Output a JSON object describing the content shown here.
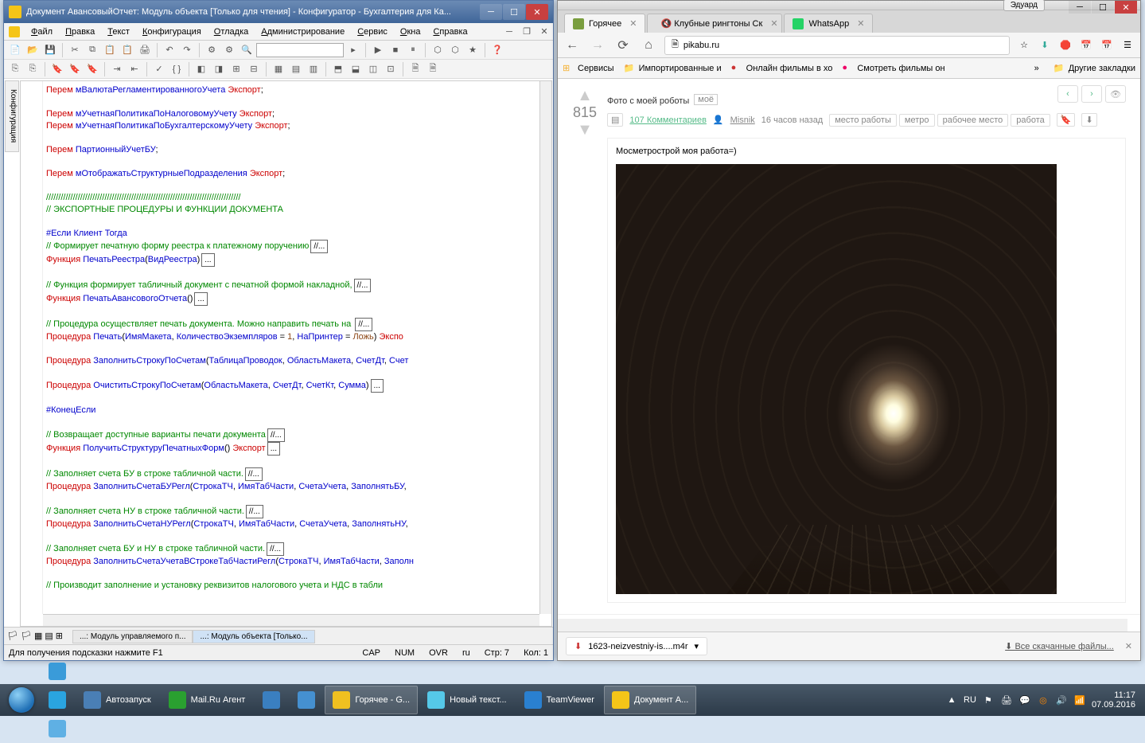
{
  "leftWindow": {
    "title": "Документ АвансовыйОтчет: Модуль объекта [Только для чтения] - Конфигуратор - Бухгалтерия для Ка...",
    "menu": [
      "Файл",
      "Правка",
      "Текст",
      "Конфигурация",
      "Отладка",
      "Администрирование",
      "Сервис",
      "Окна",
      "Справка"
    ],
    "sidebarTab": "Конфигурация",
    "code": [
      {
        "t": "",
        "p": [
          [
            "kw-red",
            "Перем "
          ],
          [
            "kw-blue",
            "мВалютаРегламентированногоУчета "
          ],
          [
            "kw-red",
            "Экспорт"
          ],
          [
            "",
            ";"
          ]
        ]
      },
      {
        "t": "blank"
      },
      {
        "t": "",
        "p": [
          [
            "kw-red",
            "Перем "
          ],
          [
            "kw-blue",
            "мУчетнаяПолитикаПоНалоговомуУчету "
          ],
          [
            "kw-red",
            "Экспорт"
          ],
          [
            "",
            ";"
          ]
        ]
      },
      {
        "t": "",
        "p": [
          [
            "kw-red",
            "Перем "
          ],
          [
            "kw-blue",
            "мУчетнаяПолитикаПоБухгалтерскомуУчету "
          ],
          [
            "kw-red",
            "Экспорт"
          ],
          [
            "",
            ";"
          ]
        ]
      },
      {
        "t": "blank"
      },
      {
        "t": "",
        "p": [
          [
            "kw-red",
            "Перем "
          ],
          [
            "kw-blue",
            "ПартионныйУчетБУ"
          ],
          [
            "",
            ";"
          ]
        ]
      },
      {
        "t": "blank"
      },
      {
        "t": "",
        "p": [
          [
            "kw-red",
            "Перем "
          ],
          [
            "kw-blue",
            "мОтображатьСтруктурныеПодразделения "
          ],
          [
            "kw-red",
            "Экспорт"
          ],
          [
            "",
            ";"
          ]
        ]
      },
      {
        "t": "blank"
      },
      {
        "t": "",
        "p": [
          [
            "kw-green",
            "////////////////////////////////////////////////////////////////////////////////"
          ]
        ]
      },
      {
        "t": "",
        "p": [
          [
            "kw-green",
            "// ЭКСПОРТНЫЕ ПРОЦЕДУРЫ И ФУНКЦИИ ДОКУМЕНТА"
          ]
        ]
      },
      {
        "t": "blank"
      },
      {
        "t": "",
        "p": [
          [
            "kw-blue",
            "#Если Клиент Тогда"
          ]
        ]
      },
      {
        "t": "fold",
        "p": [
          [
            "kw-green",
            "// Формирует печатную форму реестра к платежному поручению"
          ]
        ],
        "box": "//..."
      },
      {
        "t": "fold",
        "p": [
          [
            "kw-red",
            "Функция "
          ],
          [
            "kw-blue",
            "ПечатьРеестра"
          ],
          [
            "",
            "("
          ],
          [
            "kw-blue",
            "ВидРеестра"
          ],
          [
            "",
            ")"
          ]
        ],
        "box": "..."
      },
      {
        "t": "blank"
      },
      {
        "t": "fold",
        "p": [
          [
            "kw-green",
            "// Функция формирует табличный документ с печатной формой накладной,"
          ]
        ],
        "box": "//..."
      },
      {
        "t": "fold",
        "p": [
          [
            "kw-red",
            "Функция "
          ],
          [
            "kw-blue",
            "ПечатьАвансовогоОтчета"
          ],
          [
            "",
            "()"
          ]
        ],
        "box": "..."
      },
      {
        "t": "blank"
      },
      {
        "t": "fold",
        "p": [
          [
            "kw-green",
            "// Процедура осуществляет печать документа. Можно направить печать на "
          ]
        ],
        "box": "//..."
      },
      {
        "t": "fold",
        "p": [
          [
            "kw-red",
            "Процедура "
          ],
          [
            "kw-blue",
            "Печать"
          ],
          [
            "",
            "("
          ],
          [
            "kw-blue",
            "ИмяМакета"
          ],
          [
            "",
            ", "
          ],
          [
            "kw-blue",
            "КоличествоЭкземпляров"
          ],
          [
            "",
            " = "
          ],
          [
            "kw-brown",
            "1"
          ],
          [
            "",
            ", "
          ],
          [
            "kw-blue",
            "НаПринтер"
          ],
          [
            "",
            " = "
          ],
          [
            "kw-brown",
            "Ложь"
          ],
          [
            "",
            ") "
          ],
          [
            "kw-red",
            "Экспо"
          ]
        ]
      },
      {
        "t": "blank"
      },
      {
        "t": "fold",
        "p": [
          [
            "kw-red",
            "Процедура "
          ],
          [
            "kw-blue",
            "ЗаполнитьСтрокуПоСчетам"
          ],
          [
            "",
            "("
          ],
          [
            "kw-blue",
            "ТаблицаПроводок"
          ],
          [
            "",
            ", "
          ],
          [
            "kw-blue",
            "ОбластьМакета"
          ],
          [
            "",
            ", "
          ],
          [
            "kw-blue",
            "СчетДт"
          ],
          [
            "",
            ", "
          ],
          [
            "kw-blue",
            "Счет"
          ]
        ]
      },
      {
        "t": "blank"
      },
      {
        "t": "fold",
        "p": [
          [
            "kw-red",
            "Процедура "
          ],
          [
            "kw-blue",
            "ОчиститьСтрокуПоСчетам"
          ],
          [
            "",
            "("
          ],
          [
            "kw-blue",
            "ОбластьМакета"
          ],
          [
            "",
            ", "
          ],
          [
            "kw-blue",
            "СчетДт"
          ],
          [
            "",
            ", "
          ],
          [
            "kw-blue",
            "СчетКт"
          ],
          [
            "",
            ", "
          ],
          [
            "kw-blue",
            "Сумма"
          ],
          [
            "",
            ")"
          ]
        ],
        "box": "..."
      },
      {
        "t": "blank"
      },
      {
        "t": "",
        "p": [
          [
            "kw-blue",
            "#КонецЕсли"
          ]
        ]
      },
      {
        "t": "blank"
      },
      {
        "t": "fold",
        "p": [
          [
            "kw-green",
            "// Возвращает доступные варианты печати документа"
          ]
        ],
        "box": "//..."
      },
      {
        "t": "fold",
        "p": [
          [
            "kw-red",
            "Функция "
          ],
          [
            "kw-blue",
            "ПолучитьСтруктуруПечатныхФорм"
          ],
          [
            "",
            "() "
          ],
          [
            "kw-red",
            "Экспорт"
          ]
        ],
        "box": "..."
      },
      {
        "t": "blank"
      },
      {
        "t": "fold",
        "p": [
          [
            "kw-green",
            "// Заполняет счета БУ в строке табличной части."
          ]
        ],
        "box": "//..."
      },
      {
        "t": "fold",
        "p": [
          [
            "kw-red",
            "Процедура "
          ],
          [
            "kw-blue",
            "ЗаполнитьСчетаБУРегл"
          ],
          [
            "",
            "("
          ],
          [
            "kw-blue",
            "СтрокаТЧ"
          ],
          [
            "",
            ", "
          ],
          [
            "kw-blue",
            "ИмяТабЧасти"
          ],
          [
            "",
            ", "
          ],
          [
            "kw-blue",
            "СчетаУчета"
          ],
          [
            "",
            ", "
          ],
          [
            "kw-blue",
            "ЗаполнятьБУ"
          ],
          [
            "",
            ","
          ]
        ]
      },
      {
        "t": "blank"
      },
      {
        "t": "fold",
        "p": [
          [
            "kw-green",
            "// Заполняет счета НУ в строке табличной части."
          ]
        ],
        "box": "//..."
      },
      {
        "t": "fold",
        "p": [
          [
            "kw-red",
            "Процедура "
          ],
          [
            "kw-blue",
            "ЗаполнитьСчетаНУРегл"
          ],
          [
            "",
            "("
          ],
          [
            "kw-blue",
            "СтрокаТЧ"
          ],
          [
            "",
            ", "
          ],
          [
            "kw-blue",
            "ИмяТабЧасти"
          ],
          [
            "",
            ", "
          ],
          [
            "kw-blue",
            "СчетаУчета"
          ],
          [
            "",
            ", "
          ],
          [
            "kw-blue",
            "ЗаполнятьНУ"
          ],
          [
            "",
            ","
          ]
        ]
      },
      {
        "t": "blank"
      },
      {
        "t": "fold",
        "p": [
          [
            "kw-green",
            "// Заполняет счета БУ и НУ в строке табличной части."
          ]
        ],
        "box": "//..."
      },
      {
        "t": "fold",
        "p": [
          [
            "kw-red",
            "Процедура "
          ],
          [
            "kw-blue",
            "ЗаполнитьСчетаУчетаВСтрокеТабЧастиРегл"
          ],
          [
            "",
            "("
          ],
          [
            "kw-blue",
            "СтрокаТЧ"
          ],
          [
            "",
            ", "
          ],
          [
            "kw-blue",
            "ИмяТабЧасти"
          ],
          [
            "",
            ", "
          ],
          [
            "kw-blue",
            "Заполн"
          ]
        ]
      },
      {
        "t": "blank"
      },
      {
        "t": "fold",
        "p": [
          [
            "kw-green",
            "// Производит заполнение и установку реквизитов налогового учета и НДС в табли"
          ]
        ]
      }
    ],
    "bottomTabs": [
      "...: Модуль управляемого п...",
      "...: Модуль объекта [Только..."
    ],
    "bottomActiveIdx": 1,
    "status": {
      "hint": "Для получения подсказки нажмите F1",
      "cap": "CAP",
      "num": "NUM",
      "ovr": "OVR",
      "lang": "ru",
      "row": "Стр: 7",
      "col": "Кол: 1"
    }
  },
  "chrome": {
    "userBadge": "Эдуард",
    "tabs": [
      {
        "title": "Горячее",
        "fav": "#7a9e3f",
        "active": true
      },
      {
        "title": "Клубные рингтоны Ск",
        "fav": "#888",
        "active": false,
        "muted": true
      },
      {
        "title": "WhatsApp",
        "fav": "#25d366",
        "active": false
      }
    ],
    "url": "pikabu.ru",
    "bookmarks": [
      {
        "label": "Сервисы",
        "type": "apps"
      },
      {
        "label": "Импортированные и",
        "type": "folder"
      },
      {
        "label": "Онлайн фильмы в хо",
        "type": "site",
        "color": "#c33"
      },
      {
        "label": "Смотреть фильмы он",
        "type": "site",
        "color": "#e06"
      },
      {
        "label": "Другие закладки",
        "type": "folder",
        "right": true
      }
    ],
    "post": {
      "score": "815",
      "title": "Фото с моей роботы",
      "mytag": "моё",
      "comments": "107 Комментариев",
      "author": "Misnik",
      "time": "16 часов назад",
      "tags": [
        "место работы",
        "метро",
        "рабочее место",
        "работа"
      ],
      "bodyText": "Мосметрострой моя работа=)"
    },
    "download": {
      "file": "1623-neizvestniy-is....m4r",
      "all": "Все скачанные файлы..."
    }
  },
  "taskbar": {
    "pinned": [
      {
        "color": "#3a9bd9"
      },
      {
        "color": "#2aa4e0"
      },
      {
        "color": "#5fb0e4"
      }
    ],
    "items": [
      {
        "label": "Автозапуск",
        "color": "#4a7fb5"
      },
      {
        "label": "Mail.Ru Агент",
        "color": "#2aa030"
      },
      {
        "label": "",
        "color": "#3a7fc0"
      },
      {
        "label": "",
        "color": "#4590d0"
      },
      {
        "label": "Горячее - G...",
        "color": "#f0c020",
        "active": true
      },
      {
        "label": "Новый текст...",
        "color": "#55c8e8"
      },
      {
        "label": "TeamViewer",
        "color": "#2a80d0"
      },
      {
        "label": "Документ А...",
        "color": "#f5c518",
        "active": true
      }
    ],
    "tray": {
      "lang": "RU",
      "time": "11:17",
      "date": "07.09.2016"
    }
  }
}
